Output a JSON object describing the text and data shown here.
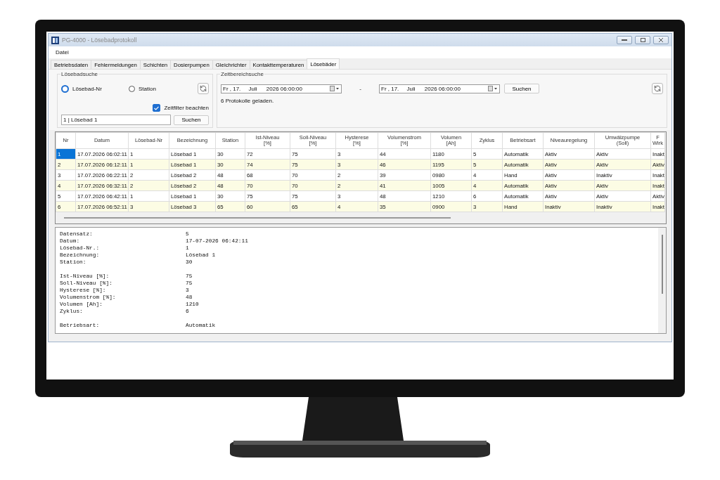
{
  "window": {
    "title": "PG-4000 - Lösebadprotokoll"
  },
  "menu": [
    "Datei"
  ],
  "tabs": [
    {
      "label": "Betriebsdaten",
      "selected": false
    },
    {
      "label": "Fehlermeldungen",
      "selected": false
    },
    {
      "label": "Schichten",
      "selected": false
    },
    {
      "label": "Dosierpumpen",
      "selected": false
    },
    {
      "label": "Gleichrichter",
      "selected": false
    },
    {
      "label": "Kontakttemperaturen",
      "selected": false
    },
    {
      "label": "Lösebäder",
      "selected": true
    }
  ],
  "bath_search": {
    "title": "Lösebadsuche",
    "radios": [
      {
        "label": "Lösebad-Nr",
        "selected": true
      },
      {
        "label": "Station",
        "selected": false
      }
    ],
    "time_filter": {
      "label": "Zeitfilter beachten",
      "checked": true
    },
    "value": "1 | Lösebad 1",
    "button": "Suchen"
  },
  "time_search": {
    "title": "Zeitbereichsuche",
    "from": "Fr , 17.     Juli      2026 06:00:00",
    "separator": "-",
    "to": "Fr , 17.     Juli      2026 06:00:00",
    "button": "Suchen",
    "status": "6 Protokolle geladen."
  },
  "table": {
    "columns": [
      "Nr",
      "Datum",
      "Lösebad-Nr",
      "Bezeichnung",
      "Station",
      "Ist-Niveau\n[%]",
      "Soll-Niveau\n[%]",
      "Hysterese\n[%]",
      "Volumenstrom\n[%]",
      "Volumen\n[Ah]",
      "Zyklus",
      "Betriebsart",
      "Niveauregelung",
      "Umwälzpumpe\n(Soll)",
      "F\nWirk"
    ],
    "rows": [
      {
        "selected": true,
        "cells": [
          "1",
          "17.07.2026 06:02:11",
          "1",
          "Lösebad 1",
          "30",
          "72",
          "75",
          "3",
          "44",
          "1180",
          "5",
          "Automatik",
          "Aktiv",
          "Aktiv",
          "Inakt"
        ]
      },
      {
        "selected": false,
        "cells": [
          "2",
          "17.07.2026 06:12:11",
          "1",
          "Lösebad 1",
          "30",
          "74",
          "75",
          "3",
          "46",
          "1195",
          "5",
          "Automatik",
          "Aktiv",
          "Aktiv",
          "Aktiv"
        ]
      },
      {
        "selected": false,
        "cells": [
          "3",
          "17.07.2026 06:22:11",
          "2",
          "Lösebad 2",
          "48",
          "68",
          "70",
          "2",
          "39",
          "0980",
          "4",
          "Hand",
          "Aktiv",
          "Inaktiv",
          "Inakt"
        ]
      },
      {
        "selected": false,
        "cells": [
          "4",
          "17.07.2026 06:32:11",
          "2",
          "Lösebad 2",
          "48",
          "70",
          "70",
          "2",
          "41",
          "1005",
          "4",
          "Automatik",
          "Aktiv",
          "Aktiv",
          "Inakt"
        ]
      },
      {
        "selected": false,
        "cells": [
          "5",
          "17.07.2026 06:42:11",
          "1",
          "Lösebad 1",
          "30",
          "75",
          "75",
          "3",
          "48",
          "1210",
          "6",
          "Automatik",
          "Aktiv",
          "Aktiv",
          "Aktiv"
        ]
      },
      {
        "selected": false,
        "cells": [
          "6",
          "17.07.2026 06:52:11",
          "3",
          "Lösebad 3",
          "65",
          "60",
          "65",
          "4",
          "35",
          "0900",
          "3",
          "Hand",
          "Inaktiv",
          "Inaktiv",
          "Inakt"
        ]
      }
    ]
  },
  "details": [
    [
      {
        "label": "Datensatz:",
        "value": "5"
      },
      {
        "label": "Datum:",
        "value": "17-07-2026 06:42:11"
      },
      {
        "label": "Lösebad-Nr.:",
        "value": "1"
      },
      {
        "label": "Bezeichnung:",
        "value": "Lösebad 1"
      },
      {
        "label": "Station:",
        "value": "30"
      }
    ],
    [
      {
        "label": "Ist-Niveau [%]:",
        "value": "75"
      },
      {
        "label": "Soll-Niveau [%]:",
        "value": "75"
      },
      {
        "label": "Hysterese [%]:",
        "value": "3"
      },
      {
        "label": "Volumenstrom [%]:",
        "value": "48"
      },
      {
        "label": "Volumen [Ah]:",
        "value": "1210"
      },
      {
        "label": "Zyklus:",
        "value": "6"
      }
    ],
    [
      {
        "label": "Betriebsart:",
        "value": "Automatik"
      }
    ]
  ]
}
